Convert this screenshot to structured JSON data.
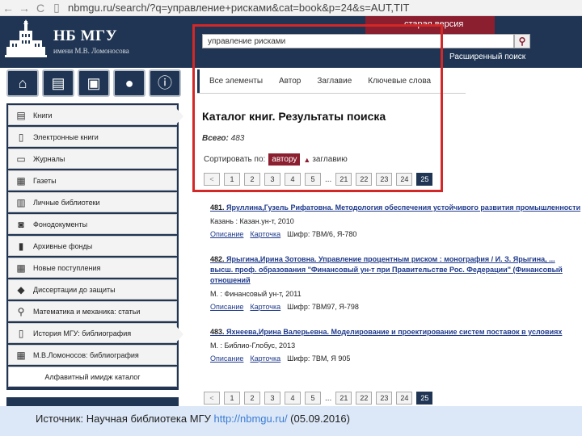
{
  "browser": {
    "back": "←",
    "forward": "→",
    "reload": "C",
    "url": "nbmgu.ru/search/?q=управление+рисками&cat=book&p=24&s=AUT,TIT"
  },
  "header": {
    "title": "НБ МГУ",
    "subtitle": "имени М.В. Ломоносова",
    "version_tab": "старая версия",
    "search_value": "управление рисками",
    "advanced_search": "Расширенный поиск"
  },
  "toolbar_icons": [
    "home-icon",
    "catalog-icon",
    "personal-account-icon",
    "user-icon",
    "info-icon"
  ],
  "sidebar": {
    "items": [
      {
        "label": "Книги",
        "icon": "books-icon"
      },
      {
        "label": "Электронные книги",
        "icon": "ebook-icon"
      },
      {
        "label": "Журналы",
        "icon": "journal-icon"
      },
      {
        "label": "Газеты",
        "icon": "newspaper-icon"
      },
      {
        "label": "Личные библиотеки",
        "icon": "personal-library-icon"
      },
      {
        "label": "Фонодокументы",
        "icon": "audio-icon"
      },
      {
        "label": "Архивные фонды",
        "icon": "archive-icon"
      },
      {
        "label": "Новые поступления",
        "icon": "calendar-icon"
      },
      {
        "label": "Диссертации до защиты",
        "icon": "graduation-icon"
      },
      {
        "label": "Математика и механика: статьи",
        "icon": "compass-icon"
      },
      {
        "label": "История МГУ: библиография",
        "icon": "book-open-icon"
      },
      {
        "label": "М.В.Ломоносов: библиография",
        "icon": "calendar-icon"
      },
      {
        "label": "Алфавитный имидж каталог",
        "icon": ""
      }
    ]
  },
  "tabs": [
    "Все элементы",
    "Автор",
    "Заглавие",
    "Ключевые слова"
  ],
  "catalog": {
    "title": "Каталог книг. Результаты поиска",
    "total_label": "Всего:",
    "total": "483",
    "sort_label": "Сортировать по:",
    "sort_active": "автору",
    "sort_other": "заглавию"
  },
  "pager": {
    "prev": "<",
    "pages": [
      "1",
      "2",
      "3",
      "4",
      "5"
    ],
    "dots": "...",
    "last_pages": [
      "21",
      "22",
      "23",
      "24",
      "25"
    ]
  },
  "results": [
    {
      "num": "481.",
      "title": "Яруллина,Гузель Рифатовна. Методология обеспечения устойчивого развития промышленности",
      "line": "Казань : Казан.ун-т, 2010",
      "links": [
        "Описание",
        "Карточка"
      ],
      "shelf": "Шифр: 7ВМ/6, Я-780"
    },
    {
      "num": "482.",
      "title": "Ярыгина,Ирина Зотовна. Управление процентным риском : монография / И. З. Ярыгина, ...",
      "title2": "высш. проф. образования \"Финансовый ун-т при Правительстве Рос. Федерации\" (Финансовый",
      "title3": "отношений",
      "line": "М. : Финансовый ун-т, 2011",
      "links": [
        "Описание",
        "Карточка"
      ],
      "shelf": "Шифр: 7ВМ97, Я-798"
    },
    {
      "num": "483.",
      "title": "Яхнеева,Ирина Валерьевна. Моделирование и проектирование систем поставок в условиях",
      "line": "М. : Библио-Глобус, 2013",
      "links": [
        "Описание",
        "Карточка"
      ],
      "shelf": "Шифр: 7ВМ, Я 905"
    }
  ],
  "footer": {
    "prefix": "Источник: Научная библиотека МГУ",
    "link": "http://nbmgu.ru/",
    "suffix": " (05.09.2016)"
  }
}
